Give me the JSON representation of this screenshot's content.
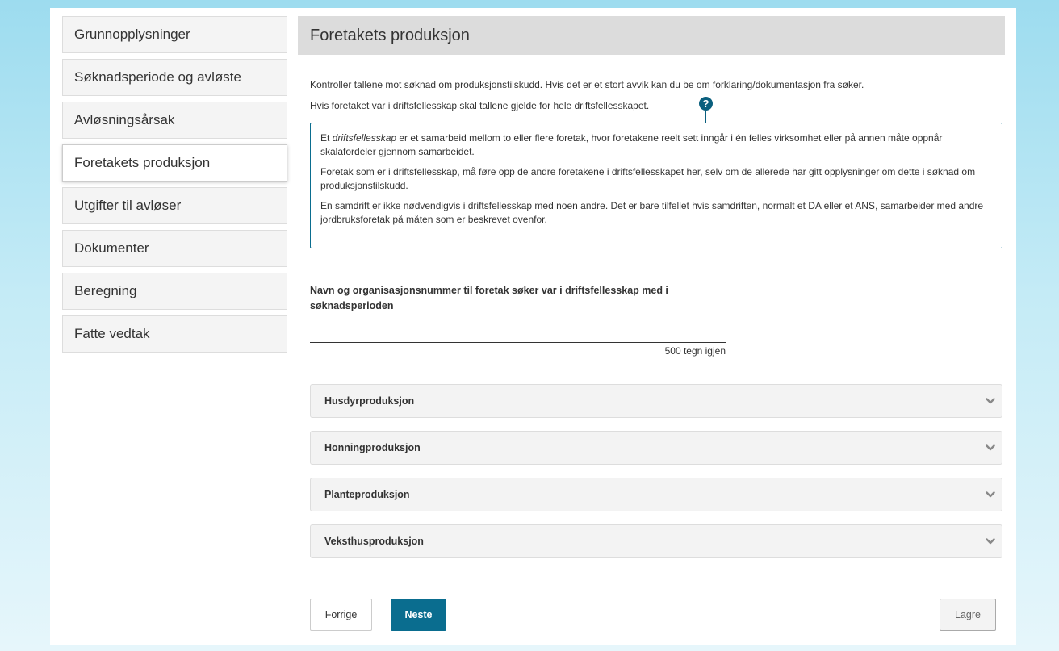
{
  "sidebar": {
    "items": [
      {
        "label": "Grunnopplysninger"
      },
      {
        "label": "Søknadsperiode og avløste"
      },
      {
        "label": "Avløsningsårsak"
      },
      {
        "label": "Foretakets produksjon"
      },
      {
        "label": "Utgifter til avløser"
      },
      {
        "label": "Dokumenter"
      },
      {
        "label": "Beregning"
      },
      {
        "label": "Fatte vedtak"
      }
    ],
    "active_index": 3
  },
  "main": {
    "title": "Foretakets produksjon",
    "intro": "Kontroller tallene mot søknad om produksjonstilskudd. Hvis det er et stort avvik kan du be om forklaring/dokumentasjon fra søker.",
    "intro2": "Hvis foretaket var i driftsfellesskap skal tallene gjelde for hele driftsfellesskapet.",
    "help_icon": "question-circle-icon",
    "info": {
      "p1_term": "driftsfellesskap",
      "p1_start": "Et ",
      "p1_rest": " er et samarbeid mellom to eller flere foretak, hvor foretakene reelt sett inngår i én felles virksomhet eller på annen måte oppnår skalafordeler gjennom samarbeidet.",
      "p2": "Foretak som er i driftsfellesskap, må føre opp de andre foretakene i driftsfellesskapet her, selv om de allerede har gitt opplysninger om dette i søknad om produksjonstilskudd.",
      "p3": "En samdrift er ikke nødvendigvis i driftsfellesskap med noen andre. Det er bare tilfellet hvis samdriften, normalt et DA eller et ANS, samarbeider med andre jordbruksforetak på måten som er beskrevet ovenfor."
    },
    "field_label": "Navn og organisasjonsnummer til foretak søker var i driftsfellesskap med i søknadsperioden",
    "field_value": "",
    "remaining": "500 tegn igjen",
    "accordions": [
      {
        "label": "Husdyrproduksjon"
      },
      {
        "label": "Honningproduksjon"
      },
      {
        "label": "Planteproduksjon"
      },
      {
        "label": "Veksthusproduksjon"
      }
    ]
  },
  "footer": {
    "prev_label": "Forrige",
    "next_label": "Neste",
    "save_label": "Lagre"
  },
  "colors": {
    "accent": "#0a6d8f",
    "header_bg": "#dcdcdc"
  }
}
